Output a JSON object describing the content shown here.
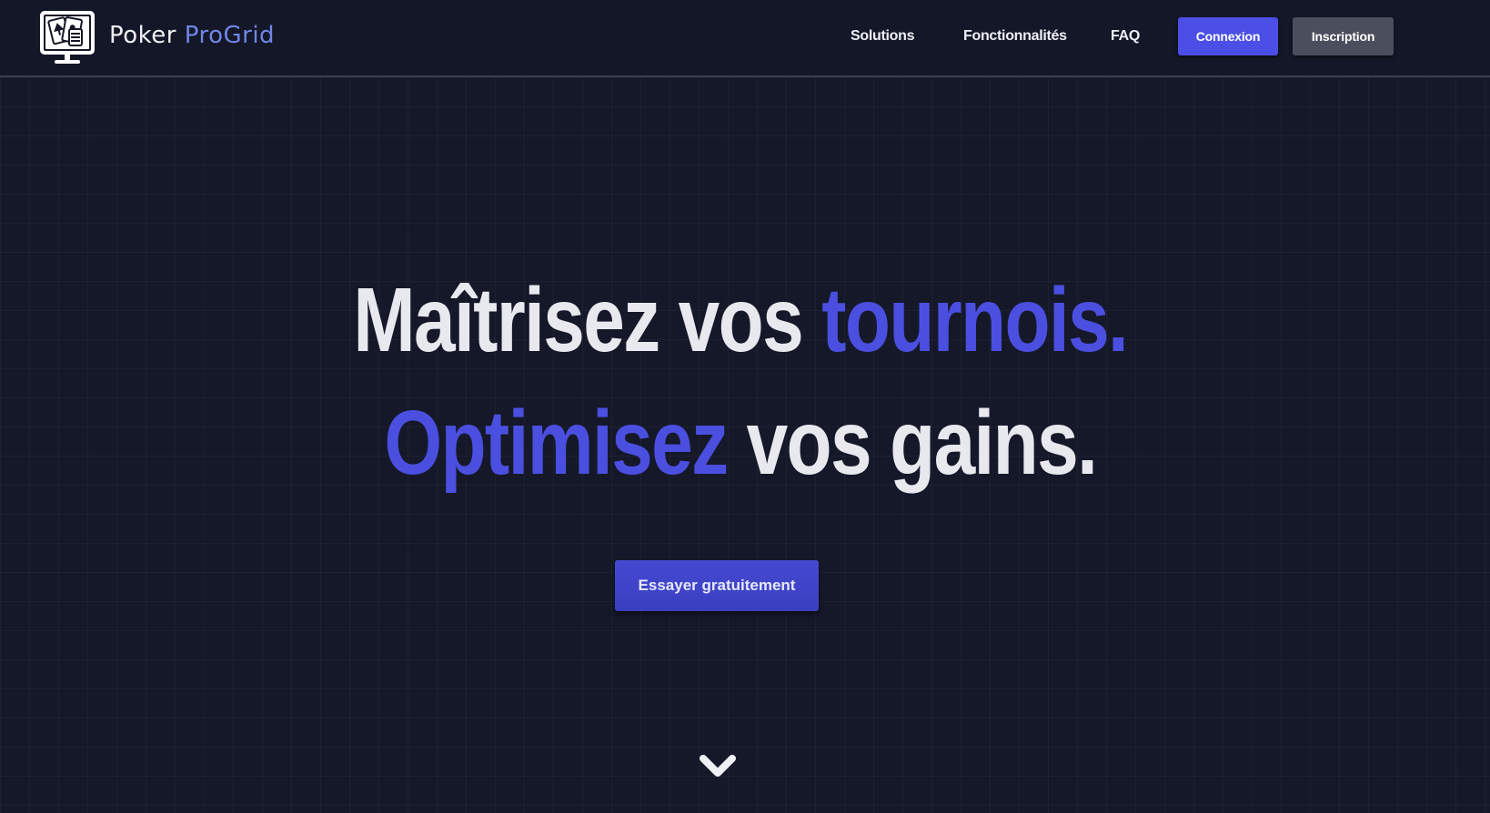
{
  "brand": {
    "name_part1": "Poker",
    "name_part2": "ProGrid",
    "logo_icon": "poker-monitor-icon",
    "accent_color": "#6f86e6"
  },
  "nav": {
    "links": [
      "Solutions",
      "Fonctionnalités",
      "FAQ"
    ],
    "login_label": "Connexion",
    "signup_label": "Inscription"
  },
  "hero": {
    "line1_plain": "Maîtrisez vos",
    "line1_highlight": "tournois.",
    "line2_highlight": "Optimisez",
    "line2_plain": "vos gains.",
    "highlight_color": "#4b4fe0",
    "cta_label": "Essayer gratuitement",
    "scroll_icon": "chevron-down-icon"
  }
}
